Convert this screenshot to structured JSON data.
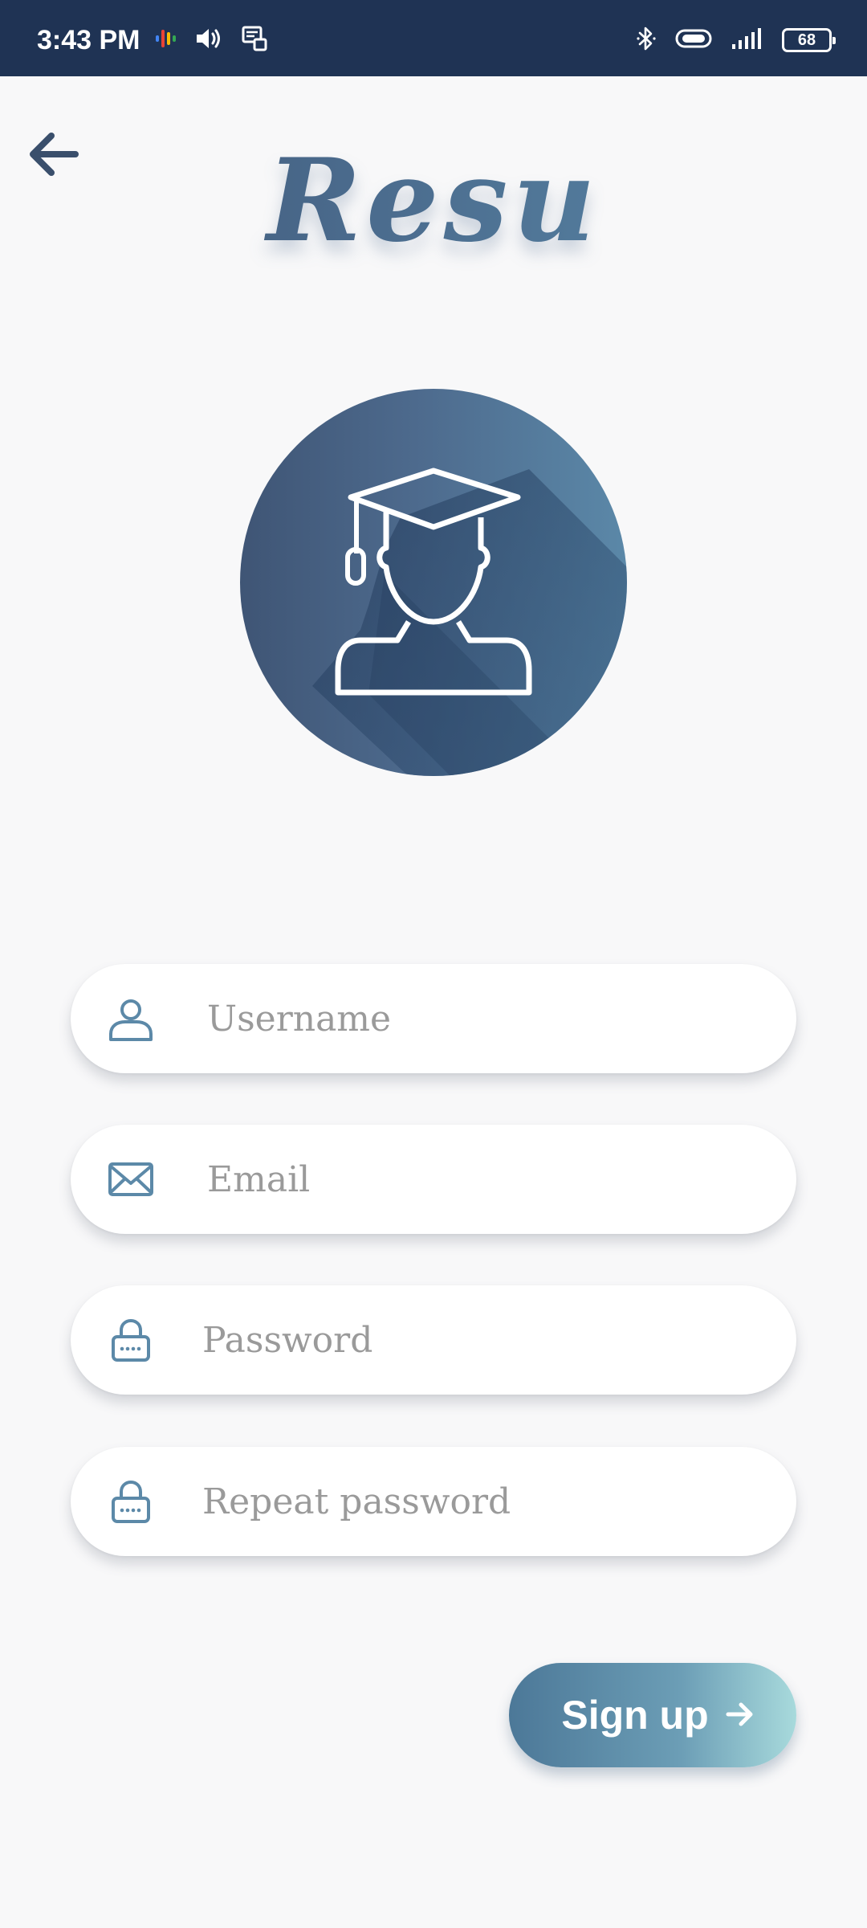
{
  "status_bar": {
    "time": "3:43 PM",
    "battery_level": "68",
    "icons_left": [
      "assistant-icon",
      "volume-icon",
      "screen-mirror-icon"
    ],
    "icons_right": [
      "bluetooth-icon",
      "vibrate-icon",
      "signal-icon",
      "battery-icon"
    ]
  },
  "header": {
    "back_icon": "arrow-left-icon",
    "app_name": "Resu"
  },
  "avatar": {
    "icon": "graduate-icon"
  },
  "form": {
    "username_placeholder": "Username",
    "email_placeholder": "Email",
    "password_placeholder": "Password",
    "repeat_password_placeholder": "Repeat password",
    "username_icon": "user-icon",
    "email_icon": "envelope-icon",
    "password_icon": "lock-icon"
  },
  "actions": {
    "signup_label": "Sign up",
    "signup_icon": "arrow-right-icon"
  },
  "colors": {
    "status_bar": "#1f3354",
    "primary_dark": "#3d5676",
    "primary_light": "#5b88a8",
    "accent_light": "#a8dadc",
    "background": "#f8f8f9"
  }
}
